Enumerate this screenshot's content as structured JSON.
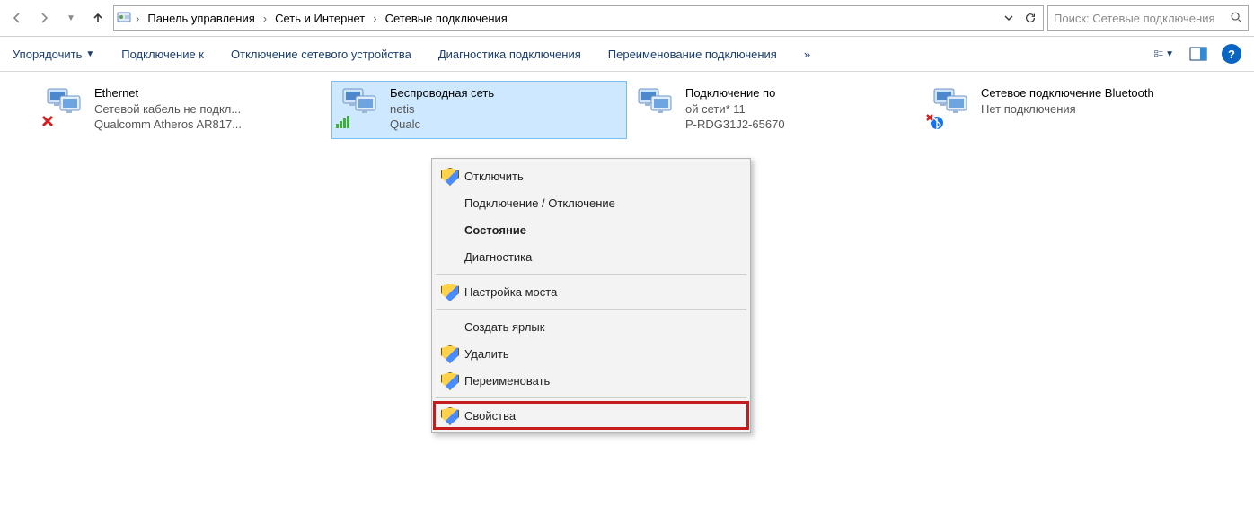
{
  "address_bar": {
    "breadcrumbs": [
      "Панель управления",
      "Сеть и Интернет",
      "Сетевые подключения"
    ]
  },
  "search": {
    "placeholder": "Поиск: Сетевые подключения"
  },
  "toolbar": {
    "organize": "Упорядочить",
    "items": [
      "Подключение к",
      "Отключение сетевого устройства",
      "Диагностика подключения",
      "Переименование подключения"
    ],
    "more": "»"
  },
  "connections": [
    {
      "title": "Ethernet",
      "line2": "Сетевой кабель не подкл...",
      "line3": "Qualcomm Atheros AR817...",
      "overlay": "error",
      "icon": "ethernet"
    },
    {
      "title": "Беспроводная сеть",
      "line2": "netis",
      "line3": "Qualc",
      "overlay": "signal",
      "icon": "wifi",
      "selected": true
    },
    {
      "title": "Подключение по",
      "line2": "ой сети* 11",
      "line3": "P-RDG31J2-65670",
      "overlay": "none",
      "icon": "local"
    },
    {
      "title": "Сетевое подключение Bluetooth",
      "line2": "Нет подключения",
      "line3": "",
      "overlay": "bt-error",
      "icon": "bluetooth"
    }
  ],
  "context_menu": {
    "items": [
      {
        "label": "Отключить",
        "shield": true
      },
      {
        "label": "Подключение / Отключение"
      },
      {
        "label": "Состояние",
        "bold": true
      },
      {
        "label": "Диагностика"
      },
      {
        "sep": true
      },
      {
        "label": "Настройка моста",
        "shield": true
      },
      {
        "sep": true
      },
      {
        "label": "Создать ярлык"
      },
      {
        "label": "Удалить",
        "shield": true
      },
      {
        "label": "Переименовать",
        "shield": true
      },
      {
        "sep": true
      },
      {
        "label": "Свойства",
        "shield": true,
        "highlight": true
      }
    ]
  }
}
